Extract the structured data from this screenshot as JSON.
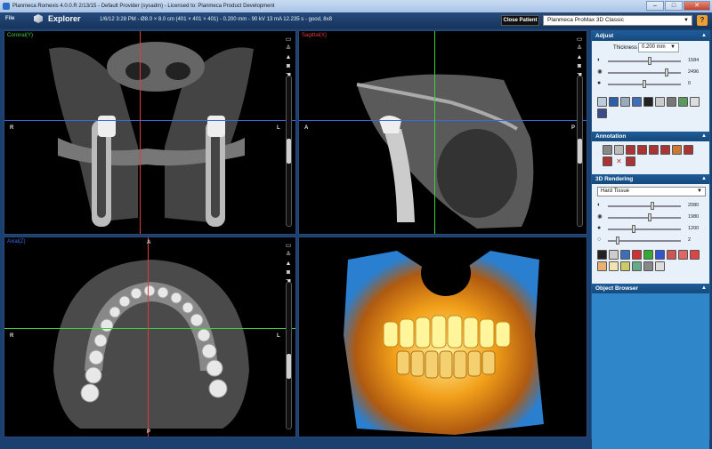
{
  "window": {
    "title": "Planmeca Romexis 4.0.0.R  2/13/15 - Default Provider (sysadm) - Licensed to: Planmeca Product Development",
    "min_label": "–",
    "max_label": "□",
    "close_label": "✕"
  },
  "toolbar": {
    "file_label": "File",
    "explorer_label": "Explorer",
    "study_info": "1/6/12 3:28 PM - Ø8.0 × 8.0 cm (401 × 401 × 401) - 0.200 mm - 90 kV 13 mA 12.235 s - good, 8x8",
    "close_patient_label": "Close Patient",
    "protocol_value": "Planmeca ProMax 3D Classic",
    "help_label": "?"
  },
  "viewports": {
    "coronal": {
      "label": "Coronal(Y)",
      "label_color": "#3ecf3e",
      "left": "R",
      "right": "L"
    },
    "sagittal": {
      "label": "Sagittal(X)",
      "label_color": "#e23a3a",
      "left": "A",
      "right": "P"
    },
    "axial": {
      "label": "Axial(Z)",
      "label_color": "#3a6ae2",
      "top": "A",
      "bottom": "P",
      "left": "R",
      "right": "L"
    },
    "tool_icons": [
      "layout-icon",
      "crosshair-toggle-icon",
      "contrast-icon",
      "camera-icon",
      "cursor-mode-icon"
    ]
  },
  "panel": {
    "adjust": {
      "title": "Adjust",
      "thickness_label": "Thickness",
      "thickness_value": "0.200 mm",
      "sliders": [
        {
          "icon": "brightness-icon",
          "value": "1584",
          "level": 0.58
        },
        {
          "icon": "contrast-icon",
          "value": "2496",
          "level": 0.82
        },
        {
          "icon": "gamma-icon",
          "value": "0",
          "level": 0.5
        }
      ]
    },
    "annotation": {
      "title": "Annotation"
    },
    "rendering": {
      "title": "3D Rendering",
      "mode_value": "Hard Tissue",
      "sliders": [
        {
          "icon": "opacity-icon",
          "value": "2080",
          "level": 0.62
        },
        {
          "icon": "window-icon",
          "value": "1980",
          "level": 0.58
        },
        {
          "icon": "threshold-icon",
          "value": "1200",
          "level": 0.35
        },
        {
          "icon": "smooth-icon",
          "value": "2",
          "level": 0.12
        }
      ]
    },
    "object_browser": {
      "title": "Object Browser"
    },
    "collapse_label": "▲"
  },
  "colors": {
    "coronal_line": "#3ecf3e",
    "sagittal_line": "#e23a3a",
    "axial_line": "#3a6ae2"
  }
}
